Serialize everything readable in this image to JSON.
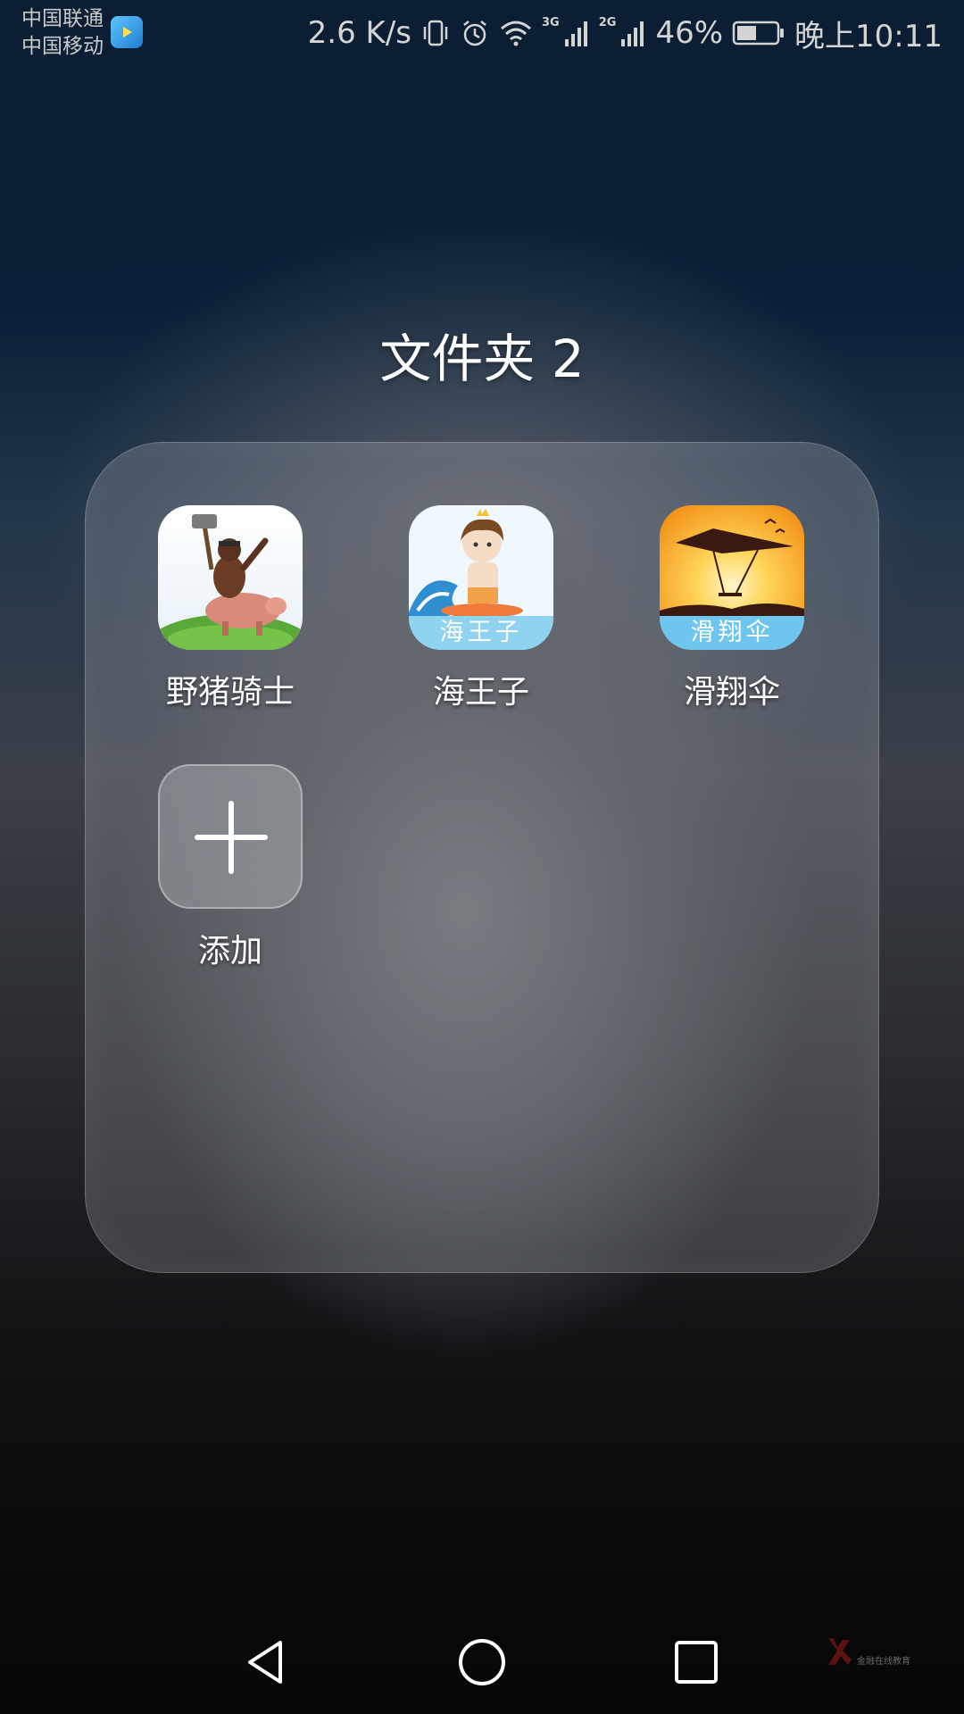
{
  "status_bar": {
    "carrier1": "中国联通",
    "carrier2": "中国移动",
    "speed": "2.6 K/s",
    "net1": "3G",
    "net2": "2G",
    "battery": "46%",
    "time": "晚上10:11",
    "icons": [
      "vibrate-icon",
      "alarm-icon",
      "wifi-icon",
      "signal-icon",
      "signal-icon",
      "battery-icon"
    ]
  },
  "folder": {
    "title": "文件夹 2",
    "apps": [
      {
        "label": "野猪骑士",
        "icon": "hog-rider-app-icon"
      },
      {
        "label": "海王子",
        "icon": "sea-prince-app-icon",
        "icon_text": "海王子"
      },
      {
        "label": "滑翔伞",
        "icon": "hang-glider-app-icon",
        "icon_text": "滑翔伞"
      }
    ],
    "add": {
      "label": "添加",
      "icon": "plus-icon"
    }
  },
  "nav": {
    "buttons": [
      "back-icon",
      "home-icon",
      "recents-icon"
    ]
  },
  "colors": {
    "text": "#ffffff",
    "sea_prince_bg": "#8fd3f0",
    "glider_sky": "#f5a21a",
    "glider_band": "#6ec6ee"
  }
}
